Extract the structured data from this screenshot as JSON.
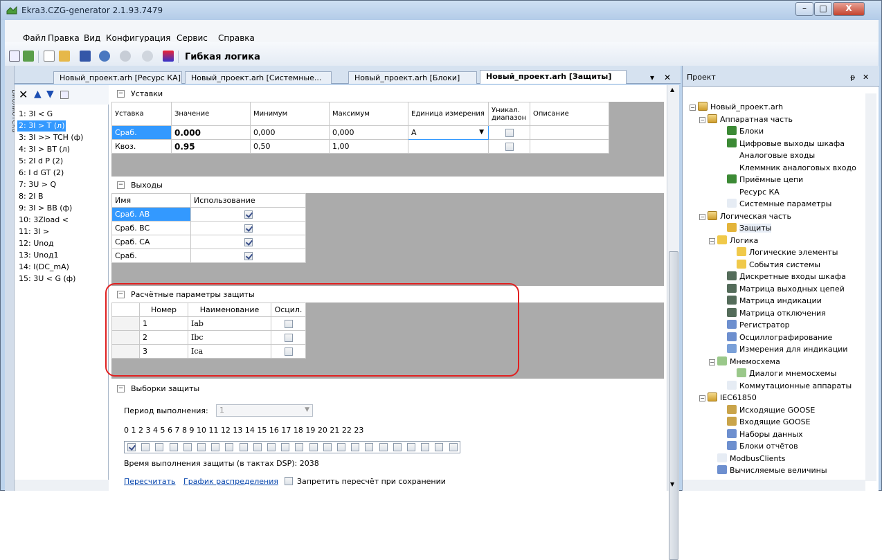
{
  "window": {
    "title": "Ekra3.CZG-generator 2.1.93.7479",
    "minimize": "–",
    "maximize": "□",
    "close": "X"
  },
  "menu": {
    "file": "Файл",
    "edit": "Правка",
    "view": "Вид",
    "config": "Конфигурация",
    "service": "Сервис",
    "help": "Справка"
  },
  "toolbar": {
    "logic_label": "Гибкая логика"
  },
  "left_tab": {
    "library": "Библиотека"
  },
  "doc_tabs": [
    {
      "label": "Новый_проект.arh [Ресурс КА]"
    },
    {
      "label": "Новый_проект.arh [Системные..."
    },
    {
      "label": "Новый_проект.arh [Блоки]"
    },
    {
      "label": "Новый_проект.arh [Защиты]"
    }
  ],
  "doc_tabs_controls": {
    "pin": "▾",
    "close": "✕"
  },
  "protections": [
    "1: 3I < G",
    "2: 3I > T (л)",
    "3: 3I >> TCH (ф)",
    "4: 3I > BT (л)",
    "5: 2I d P (2)",
    "6: I d GT (2)",
    "7: 3U > Q",
    "8: 2I B",
    "9: 3I > BB (ф)",
    "10: 3Zload <",
    "11: 3I >",
    "12: Unод",
    "13: Unод1",
    "14: I(DC_mA)",
    "15: 3U < G (ф)"
  ],
  "selected_protection": 1,
  "settings": {
    "section": "Уставки",
    "headers": [
      "Уставка",
      "Значение",
      "Минимум",
      "Максимум",
      "Единица измерения",
      "Уникал. диапазон",
      "Описание"
    ],
    "rows": [
      {
        "name": "Сраб.",
        "value": "0.000",
        "min": "0,000",
        "max": "0,000",
        "unit": "A",
        "unique": false,
        "desc": ""
      },
      {
        "name": "Квоз.",
        "value": "0.95",
        "min": "0,50",
        "max": "1,00",
        "unit": "",
        "unique": false,
        "desc": ""
      }
    ]
  },
  "outputs": {
    "section": "Выходы",
    "headers": [
      "Имя",
      "Использование"
    ],
    "rows": [
      {
        "name": "Сраб. AB",
        "use": true
      },
      {
        "name": "Сраб. BC",
        "use": true
      },
      {
        "name": "Сраб. CA",
        "use": true
      },
      {
        "name": "Сраб.",
        "use": true
      }
    ]
  },
  "calc_params": {
    "section": "Расчётные параметры защиты",
    "headers": [
      "Номер",
      "Наименование",
      "Осцил."
    ],
    "rows": [
      {
        "num": "1",
        "name": "Iab",
        "osc": false
      },
      {
        "num": "2",
        "name": "Ibc",
        "osc": false
      },
      {
        "num": "3",
        "name": "Ica",
        "osc": false
      }
    ]
  },
  "samples": {
    "section": "Выборки защиты",
    "period_label": "Период выполнения:",
    "period_value": "1",
    "digits": "0  1  2  3  4  5  6  7  8  9  10 11 12 13 14 15 16 17 18 19 20 21 22 23",
    "exec_time": "Время выполнения защиты (в тактах DSP): 2038",
    "recalc_link": "Пересчитать",
    "chart_link": "График распределения",
    "forbid_label": "Запретить пересчёт при сохранении"
  },
  "project": {
    "title": "Проект",
    "pin": "ᵽ",
    "close": "✕",
    "tree": [
      {
        "label": "Новый_проект.arh",
        "indent": 0,
        "icon": "folder-icon"
      },
      {
        "label": "Аппаратная часть",
        "indent": 1,
        "icon": "folder-icon"
      },
      {
        "label": "Блоки",
        "indent": 3,
        "icon": "blocks-icon"
      },
      {
        "label": "Цифровые выходы шкафа",
        "indent": 3,
        "icon": "blocks-icon"
      },
      {
        "label": "Аналоговые входы",
        "indent": 3,
        "icon": "analog-icon"
      },
      {
        "label": "Клеммник аналоговых входо",
        "indent": 3,
        "icon": "analog-icon"
      },
      {
        "label": "Приёмные цепи",
        "indent": 3,
        "icon": "blocks-icon"
      },
      {
        "label": "Ресурс КА",
        "indent": 3,
        "icon": "resource-icon"
      },
      {
        "label": "Системные параметры",
        "indent": 3,
        "icon": "params-icon"
      },
      {
        "label": "Логическая часть",
        "indent": 1,
        "icon": "folder-icon"
      },
      {
        "label": "Защиты",
        "indent": 3,
        "icon": "key-icon"
      },
      {
        "label": "Логика",
        "indent": 2,
        "icon": "logic-icon"
      },
      {
        "label": "Логические элементы",
        "indent": 4,
        "icon": "logic-icon"
      },
      {
        "label": "События системы",
        "indent": 4,
        "icon": "logic-icon"
      },
      {
        "label": "Дискретные входы шкафа",
        "indent": 3,
        "icon": "matrix-icon"
      },
      {
        "label": "Матрица выходных цепей",
        "indent": 3,
        "icon": "matrix-icon"
      },
      {
        "label": "Матрица индикации",
        "indent": 3,
        "icon": "matrix-icon"
      },
      {
        "label": "Матрица отключения",
        "indent": 3,
        "icon": "matrix-icon"
      },
      {
        "label": "Регистратор",
        "indent": 3,
        "icon": "recorder-icon"
      },
      {
        "label": "Осциллографирование",
        "indent": 3,
        "icon": "recorder-icon"
      },
      {
        "label": "Измерения для индикации",
        "indent": 3,
        "icon": "measure-icon"
      },
      {
        "label": "Мнемосхема",
        "indent": 2,
        "icon": "mimic-icon"
      },
      {
        "label": "Диалоги мнемосхемы",
        "indent": 4,
        "icon": "mimic-icon"
      },
      {
        "label": "Коммутационные аппараты",
        "indent": 3,
        "icon": "params-icon"
      },
      {
        "label": "IEC61850",
        "indent": 1,
        "icon": "folder-icon"
      },
      {
        "label": "Исходящие GOOSE",
        "indent": 3,
        "icon": "goose-icon"
      },
      {
        "label": "Входящие GOOSE",
        "indent": 3,
        "icon": "goose-icon"
      },
      {
        "label": "Наборы данных",
        "indent": 3,
        "icon": "recorder-icon"
      },
      {
        "label": "Блоки отчётов",
        "indent": 3,
        "icon": "recorder-icon"
      },
      {
        "label": "ModbusClients",
        "indent": 2,
        "icon": "params-icon"
      },
      {
        "label": "Вычисляемые величины",
        "indent": 2,
        "icon": "recorder-icon"
      }
    ]
  },
  "colors": {
    "selection": "#3399ff",
    "highlight_box": "#e02020",
    "link": "#0645ad"
  }
}
